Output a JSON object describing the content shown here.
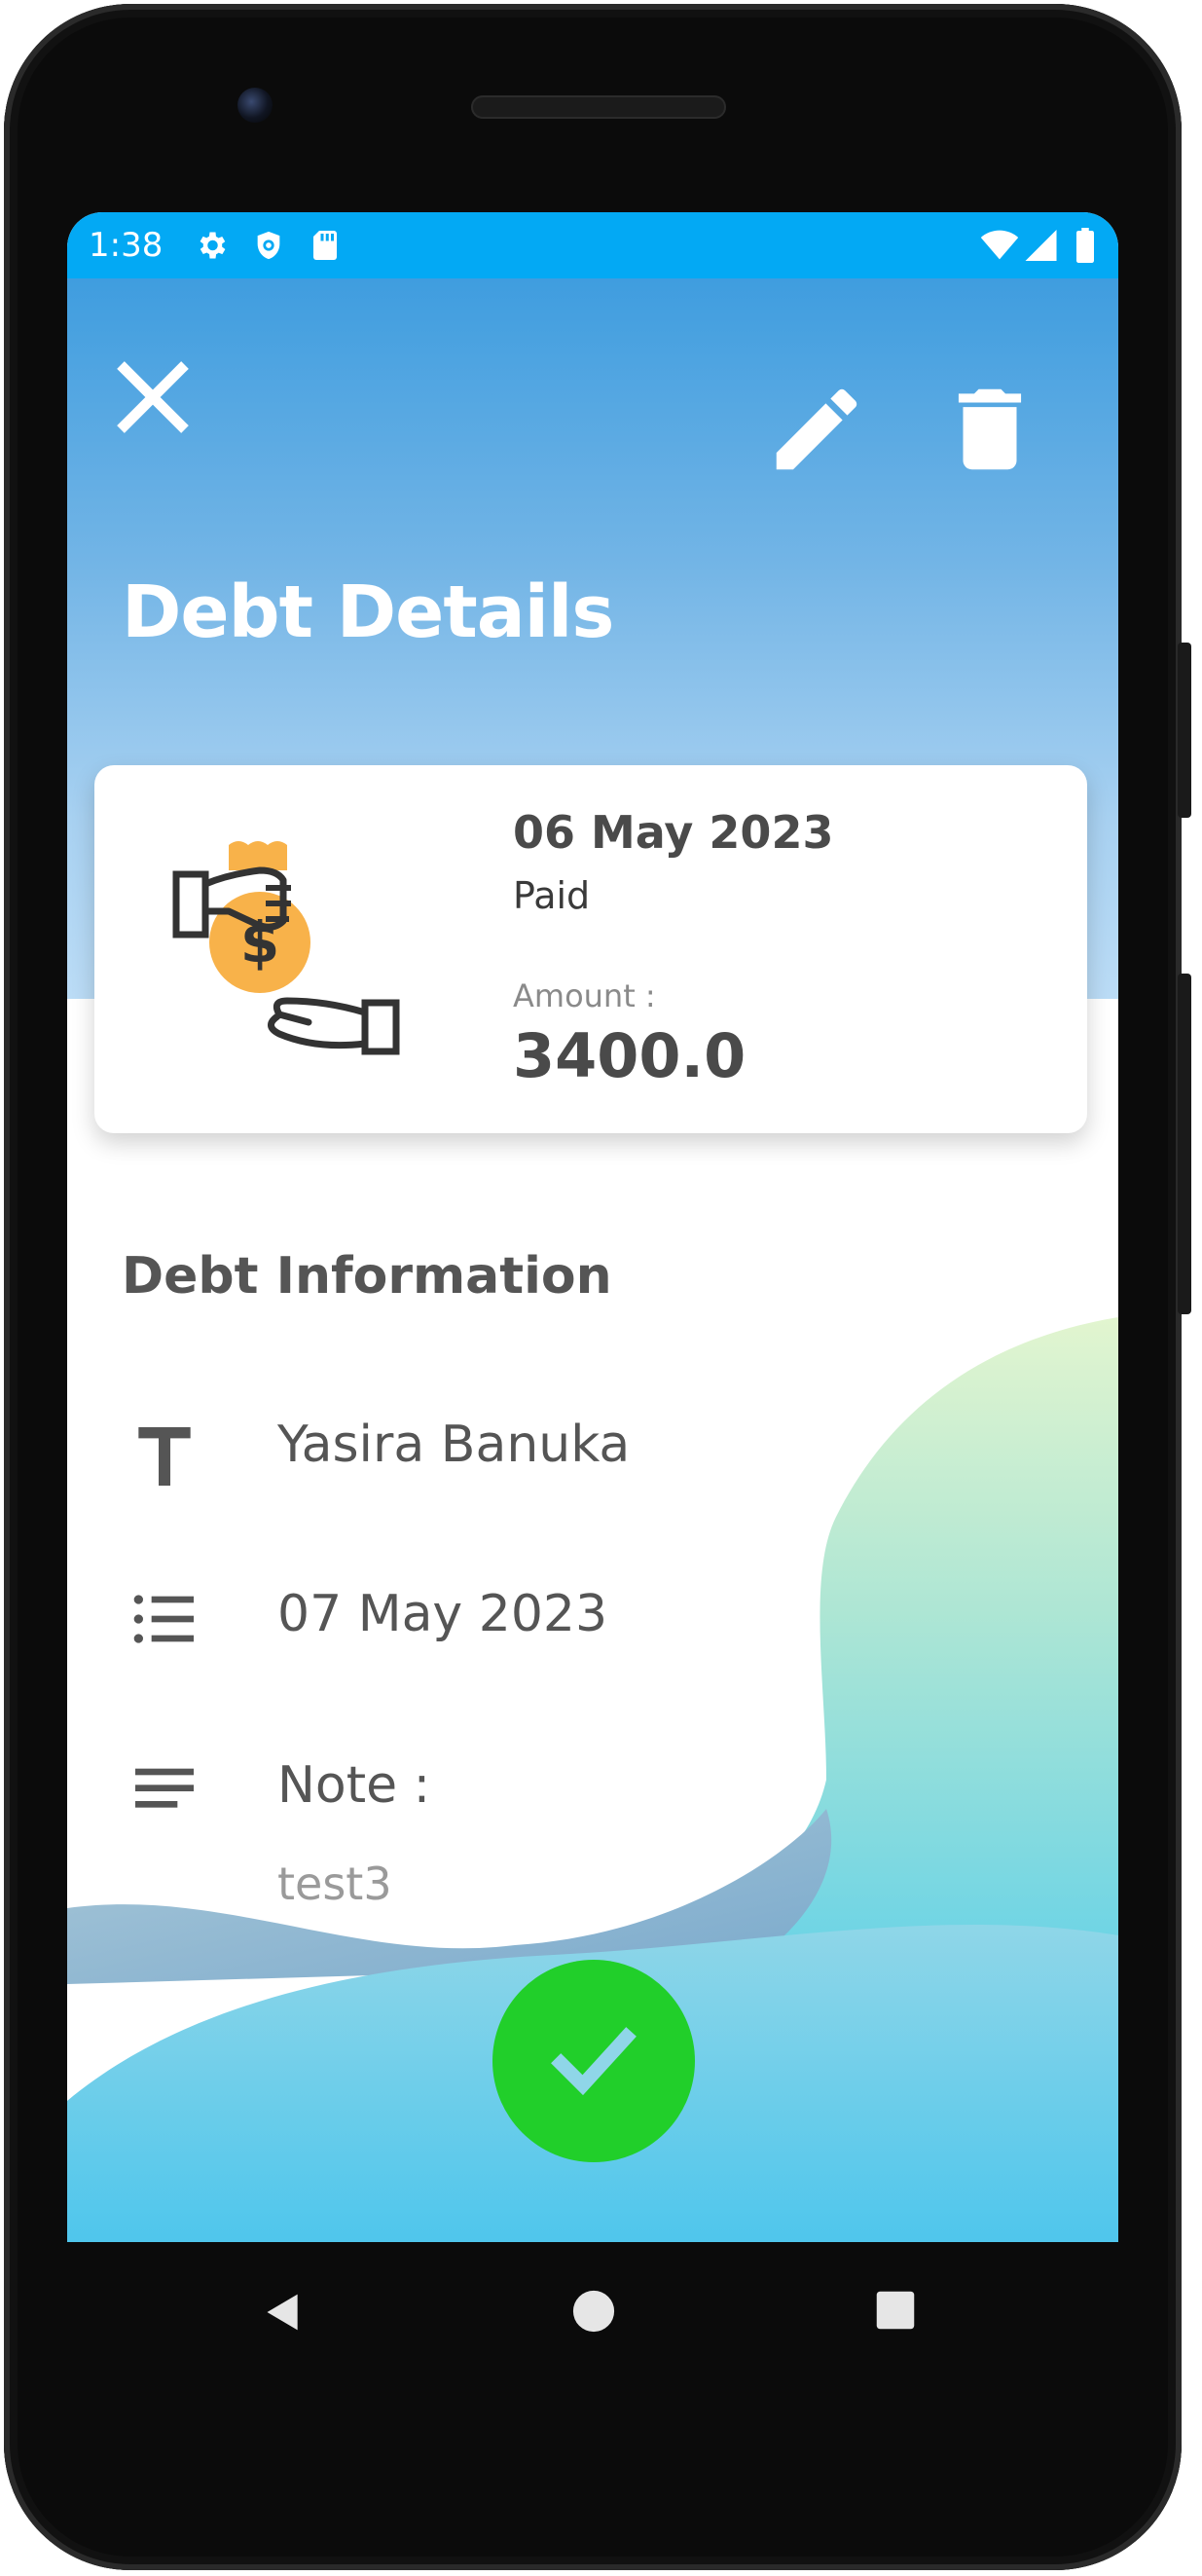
{
  "status_bar": {
    "time": "1:38",
    "left_icons": [
      "gear-icon",
      "shield-icon",
      "sd-card-icon"
    ],
    "right_icons": [
      "wifi-icon",
      "signal-icon",
      "battery-icon"
    ]
  },
  "toolbar": {
    "close_icon": "close-icon",
    "edit_icon": "edit-icon",
    "delete_icon": "delete-icon"
  },
  "page": {
    "title": "Debt Details"
  },
  "summary_card": {
    "date": "06 May 2023",
    "status": "Paid",
    "amount_label": "Amount :",
    "amount": "3400.0",
    "illustration": "money-bag-hand-icon"
  },
  "info": {
    "section_title": "Debt Information",
    "name": "Yasira Banuka",
    "date": "07 May 2023",
    "note_label": "Note :",
    "note_value": "test3"
  },
  "fab": {
    "icon": "check-icon"
  },
  "nav_bar": {
    "icons": [
      "back-icon",
      "home-icon",
      "recents-icon"
    ]
  },
  "colors": {
    "status_bar": "#03a9f4",
    "header_top": "#3f9ddf",
    "fab": "#21cf2a",
    "text_dark": "#555555",
    "coin": "#f8b24a"
  }
}
